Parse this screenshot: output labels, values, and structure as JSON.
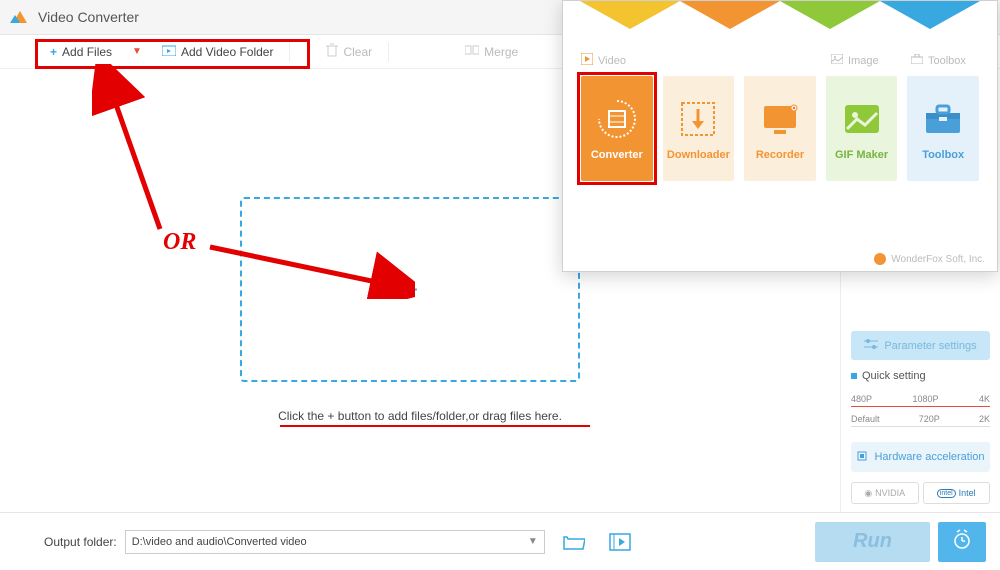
{
  "titlebar": {
    "title": "Video Converter"
  },
  "toolbar": {
    "add_files": "Add Files",
    "add_folder": "Add Video Folder",
    "clear": "Clear",
    "merge": "Merge"
  },
  "dropzone": {
    "hint": "Click the + button to add files/folder,or drag files here."
  },
  "annotation": {
    "or": "OR"
  },
  "sidebar": {
    "param": "Parameter settings",
    "quick": "Quick setting",
    "scale_top": [
      "480P",
      "1080P",
      "4K"
    ],
    "scale_bottom": [
      "Default",
      "720P",
      "2K"
    ],
    "hw": "Hardware acceleration",
    "nvidia": "NVIDIA",
    "intel": "Intel"
  },
  "bottombar": {
    "label": "Output folder:",
    "path": "D:\\video and audio\\Converted video",
    "run": "Run"
  },
  "popup": {
    "headers": {
      "video": "Video",
      "image": "Image",
      "toolbox": "Toolbox"
    },
    "tiles": {
      "converter": "Converter",
      "downloader": "Downloader",
      "recorder": "Recorder",
      "gif": "GIF Maker",
      "toolbox": "Toolbox"
    },
    "footer": "WonderFox Soft, Inc."
  }
}
